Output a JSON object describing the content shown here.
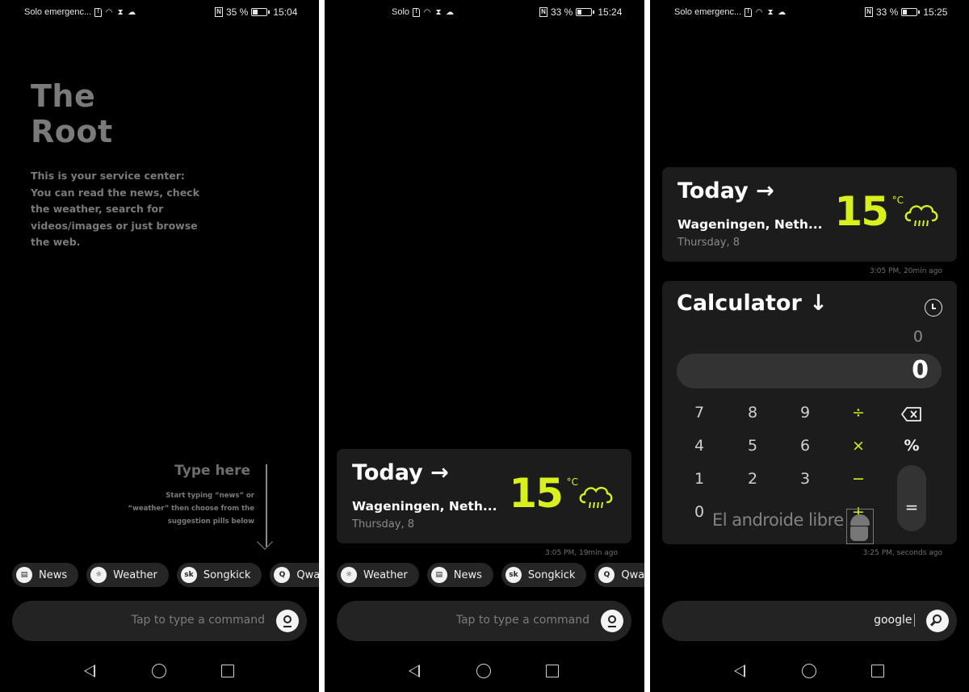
{
  "screens": [
    {
      "status": {
        "carrier": "Solo emergenc...",
        "battery_pct": "35 %",
        "battery_level": 0.35,
        "time": "15:04"
      },
      "intro": {
        "title_line1": "The",
        "title_line2": "Root",
        "description": "This is your service center: You can read the news, check the weather, search for videos/images or just browse the web."
      },
      "hint": {
        "title": "Type here",
        "text": "Start typing “news” or “weather” then choose from the suggestion pills below"
      },
      "pills": [
        {
          "label": "News",
          "icon": "news-icon"
        },
        {
          "label": "Weather",
          "icon": "sun-icon"
        },
        {
          "label": "Songkick",
          "icon": "songkick-icon"
        },
        {
          "label": "Qwant",
          "icon": "qwant-icon"
        }
      ],
      "command": {
        "placeholder": "Tap to type a command",
        "button_icon": "mic-icon"
      }
    },
    {
      "status": {
        "carrier": "Solo",
        "battery_pct": "33 %",
        "battery_level": 0.33,
        "time": "15:24"
      },
      "weather": {
        "title": "Today →",
        "location": "Wageningen, Neth...",
        "date": "Thursday, 8",
        "temp": "15",
        "unit": "°C",
        "condition_icon": "rain-cloud-icon",
        "updated": "3:05 PM, 19min ago"
      },
      "pills": [
        {
          "label": "Weather",
          "icon": "sun-icon"
        },
        {
          "label": "News",
          "icon": "news-icon"
        },
        {
          "label": "Songkick",
          "icon": "songkick-icon"
        },
        {
          "label": "Qwant",
          "icon": "qwant-icon"
        }
      ],
      "command": {
        "placeholder": "Tap to type a command",
        "button_icon": "mic-icon"
      }
    },
    {
      "status": {
        "carrier": "Solo emergenc...",
        "battery_pct": "33 %",
        "battery_level": 0.33,
        "time": "15:25"
      },
      "weather": {
        "title": "Today →",
        "location": "Wageningen, Neth...",
        "date": "Thursday, 8",
        "temp": "15",
        "unit": "°C",
        "condition_icon": "rain-cloud-icon",
        "updated": "3:05 PM, 20min ago"
      },
      "calculator": {
        "title": "Calculator ↓",
        "previous": "0",
        "display": "0",
        "keys": [
          [
            "7",
            "8",
            "9",
            "÷",
            "backspace"
          ],
          [
            "4",
            "5",
            "6",
            "×",
            "%"
          ],
          [
            "1",
            "2",
            "3",
            "−",
            ""
          ],
          [
            "0",
            "",
            "",
            "+",
            "="
          ]
        ],
        "updated": "3:25 PM, seconds ago"
      },
      "watermark": "El androide libre",
      "command": {
        "value": "google",
        "button_icon": "search-icon"
      }
    }
  ],
  "colors": {
    "accent": "#d8f01c",
    "card": "#1c1c1c",
    "pill": "#262626",
    "command_bar": "#232323",
    "background": "#000000"
  }
}
